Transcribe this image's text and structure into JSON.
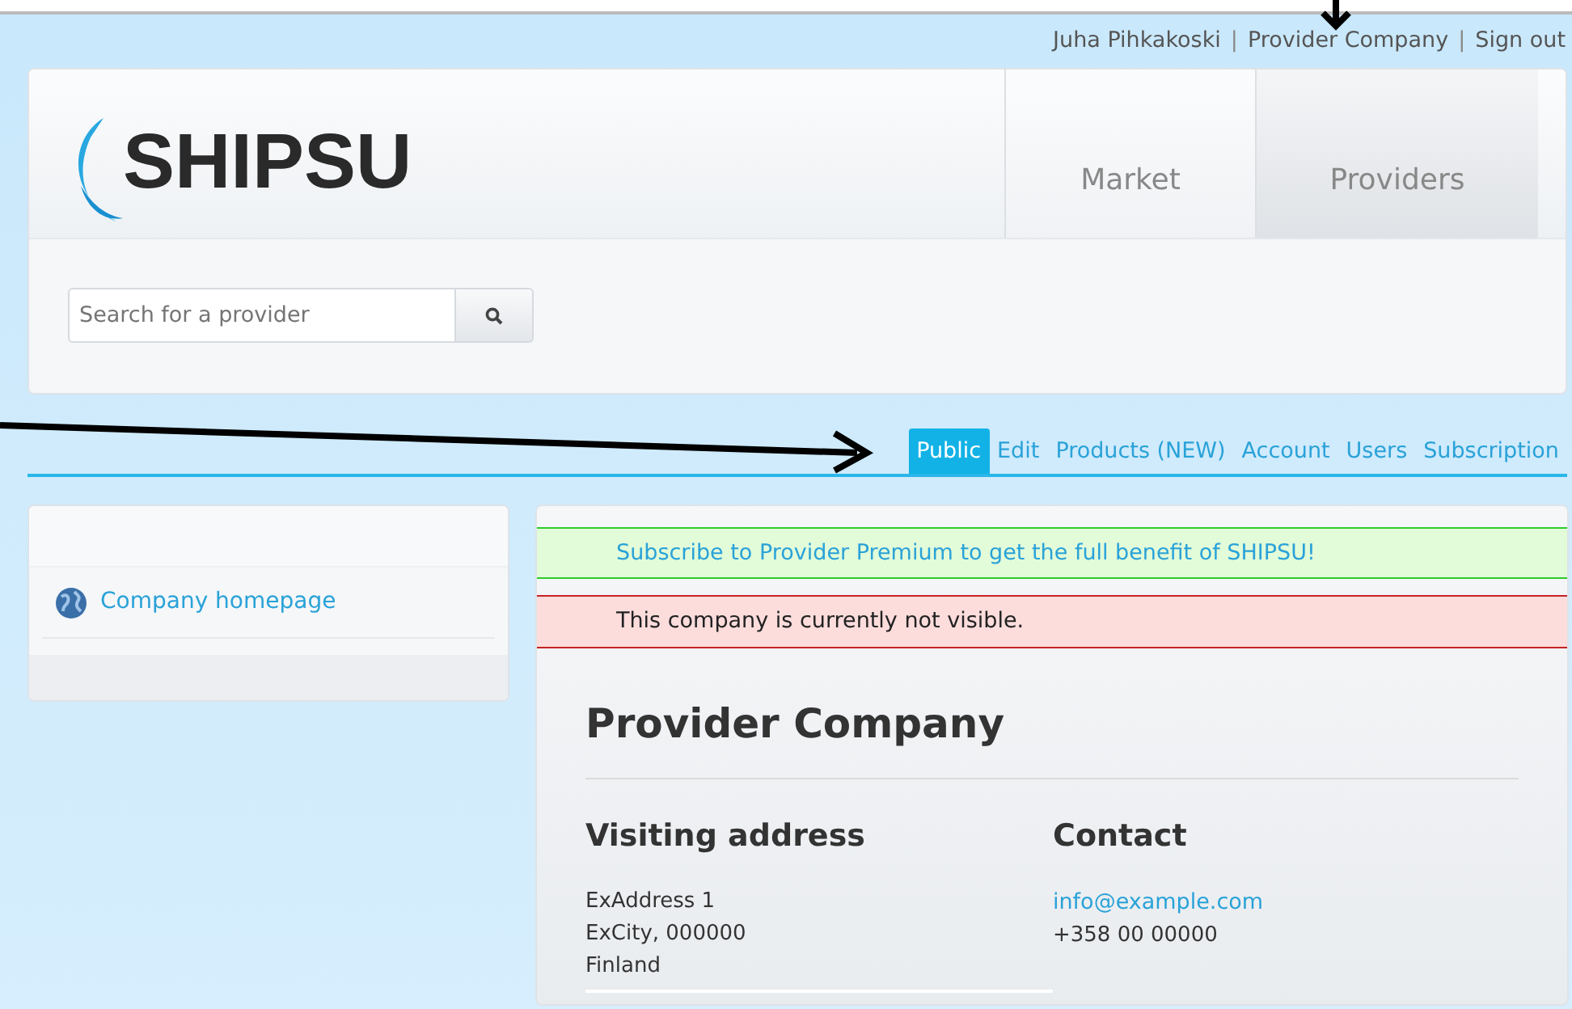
{
  "user_bar": [
    {
      "kind": "link",
      "text": "Juha Pihkakoski"
    },
    {
      "kind": "separator",
      "text": "|"
    },
    {
      "kind": "link",
      "text": "Provider Company"
    },
    {
      "kind": "separator",
      "text": "|"
    },
    {
      "kind": "link",
      "text": "Sign out"
    }
  ],
  "header": {
    "logo": "SHIPSU",
    "nav": [
      {
        "label": "Market",
        "selected": false
      },
      {
        "label": "Providers",
        "selected": true
      }
    ],
    "search": {
      "placeholder": "Search for a provider"
    }
  },
  "tabs": [
    {
      "label": "Public",
      "selected": true
    },
    {
      "label": "Edit",
      "selected": false
    },
    {
      "label": "Products (NEW)",
      "selected": false
    },
    {
      "label": "Account",
      "selected": false
    },
    {
      "label": "Users",
      "selected": false
    },
    {
      "label": "Subscription",
      "selected": false
    }
  ],
  "sidebar": {
    "links": [
      {
        "text": "Company homepage"
      }
    ]
  },
  "alerts": [
    {
      "kind": "success",
      "text": "Subscribe to Provider Premium to get the full benefit of SHIPSU!"
    },
    {
      "kind": "danger",
      "text": "This company is currently not visible."
    }
  ],
  "company": {
    "name": "Provider Company",
    "address_heading": "Visiting address",
    "address": [
      "ExAddress 1",
      "ExCity, 000000",
      "Finland"
    ],
    "contact_heading": "Contact",
    "email": "info@example.com",
    "phone": "+358 00 00000"
  }
}
